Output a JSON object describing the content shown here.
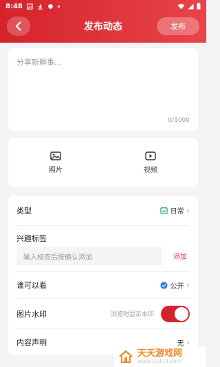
{
  "status_bar": {
    "time": "8:48"
  },
  "header": {
    "title": "发布动态",
    "publish_label": "发布"
  },
  "composer": {
    "placeholder": "分享新鲜事...",
    "counter": "0/1000"
  },
  "media": [
    {
      "label": "照片",
      "icon": "image-icon"
    },
    {
      "label": "视频",
      "icon": "video-icon"
    }
  ],
  "form": {
    "type_label": "类型",
    "type_value": "日常",
    "tags_label": "兴趣标签",
    "tags_placeholder": "输入标签后按确认添加",
    "tags_add": "添加",
    "visibility_label": "谁可以看",
    "visibility_value": "公开",
    "watermark_label": "图片水印",
    "watermark_hint": "浏览时显示水印",
    "watermark_enabled": true,
    "declaration_label": "内容声明",
    "declaration_value": "无"
  },
  "overlay_watermark": {
    "brand": "天天游戏网",
    "url": "www.ttyl23.com"
  },
  "colors": {
    "accent": "#d5232b",
    "link": "#e23a3a",
    "type_icon": "#23a86a",
    "visibility_icon": "#2d7be5"
  }
}
